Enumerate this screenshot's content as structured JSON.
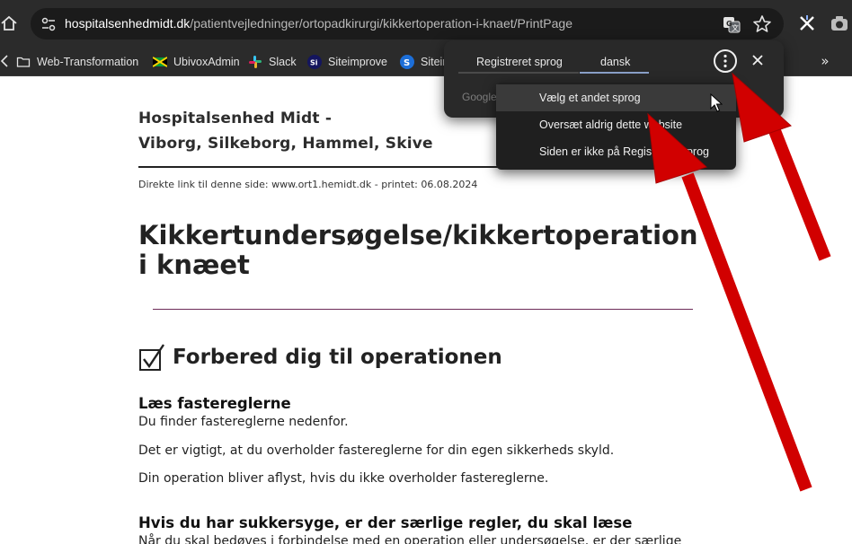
{
  "browser": {
    "url_host": "hospitalsenhedmidt.dk",
    "url_path": "/patientvejledninger/ortopadkirurgi/kikkertoperation-i-knaet/PrintPage",
    "bookmarks": [
      {
        "label": "Web-Transformation",
        "icon": "folder-icon"
      },
      {
        "label": "UbivoxAdmin",
        "icon": "jamaica-flag-icon"
      },
      {
        "label": "Slack",
        "icon": "slack-icon"
      },
      {
        "label": "Siteimprove",
        "icon": "si-icon"
      },
      {
        "label": "Siteim",
        "icon": "s-icon"
      }
    ],
    "more_bookmarks": "»"
  },
  "translate_popup": {
    "tab_detected": "Registreret sprog",
    "tab_language": "dansk",
    "sub_text": "Google",
    "menu": [
      {
        "label": "Vælg et andet sprog",
        "hover": true
      },
      {
        "label": "Oversæt aldrig dette website",
        "hover": false
      },
      {
        "label": "Siden er ikke på Registreret sprog",
        "hover": false
      }
    ]
  },
  "page": {
    "org_line1": "Hospitalsenhed Midt -",
    "org_line2": "Viborg, Silkeborg, Hammel, Skive",
    "direct_link": "Direkte link til denne side: www.ort1.hemidt.dk - printet: 06.08.2024",
    "title": "Kikkertundersøgelse/kikkertoperation i knæet",
    "section_title": "Forbered dig til operationen",
    "fast_heading": "Læs fastereglerne",
    "fast_p1": "Du finder fastereglerne nedenfor.",
    "fast_p2": "Det er vigtigt, at du overholder fastereglerne for din egen sikkerheds skyld.",
    "fast_p3": "Din operation bliver aflyst, hvis du ikke overholder fastereglerne.",
    "diabetes_heading": "Hvis du har sukkersyge, er der særlige regler, du skal læse",
    "diabetes_p1": "Når du skal bedøves i forbindelse med en operation eller undersøgelse, er der særlige"
  },
  "colors": {
    "chrome_bg": "#2b2b2b",
    "annotation_arrow": "#d10000",
    "title_rule": "#6d2b58"
  }
}
